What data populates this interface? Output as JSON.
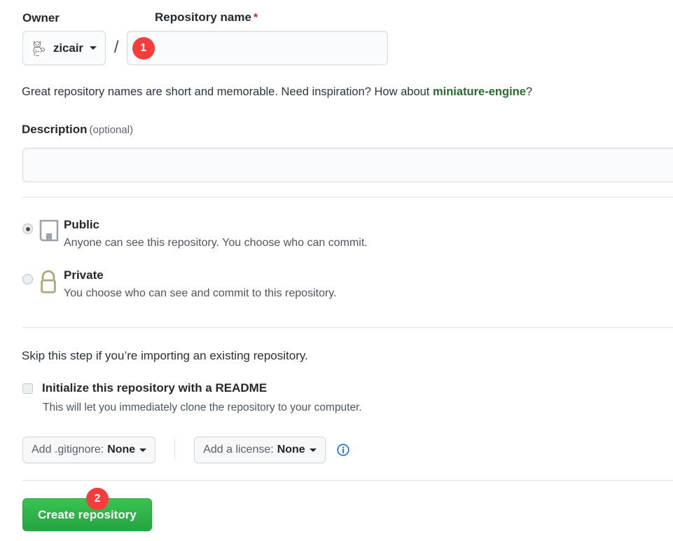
{
  "form": {
    "owner": {
      "label": "Owner",
      "name": "zicair",
      "avatar_icon": "user-avatar-sketch"
    },
    "separator": "/",
    "repository_name": {
      "label": "Repository name",
      "required_marker": "*",
      "value": "",
      "placeholder": ""
    },
    "hint": {
      "prefix": "Great repository names are short and memorable. Need inspiration? How about ",
      "suggestion": "miniature-engine",
      "suffix": "?",
      "suggestion_color": "#2b6a30"
    },
    "description": {
      "label": "Description",
      "optional_label": "(optional)",
      "value": "",
      "placeholder": ""
    },
    "visibility": {
      "selected": "public",
      "options": [
        {
          "id": "public",
          "title": "Public",
          "description": "Anyone can see this repository. You choose who can commit.",
          "icon": "repo-book-icon",
          "icon_color": "#8b949e",
          "checked": true
        },
        {
          "id": "private",
          "title": "Private",
          "description": "You choose who can see and commit to this repository.",
          "icon": "lock-icon",
          "icon_color": "#b3a57a",
          "checked": false
        }
      ]
    },
    "initialize": {
      "skip_note": "Skip this step if you’re importing an existing repository.",
      "readme_label": "Initialize this repository with a README",
      "readme_sublabel": "This will let you immediately clone the repository to your computer.",
      "readme_checked": false
    },
    "gitignore": {
      "prefix": "Add .gitignore:",
      "value": "None"
    },
    "license": {
      "prefix": "Add a license:",
      "value": "None",
      "info_icon": "info-circle-icon",
      "info_icon_color": "#0366d6"
    },
    "submit": {
      "label": "Create repository",
      "color": "#2ea44f"
    }
  },
  "annotations": {
    "badges": [
      {
        "id": "badge-1",
        "text": "1",
        "target": "repository-name-input",
        "color": "#f73c3c"
      },
      {
        "id": "badge-2",
        "text": "2",
        "target": "create-repository-button",
        "color": "#f73c3c"
      }
    ]
  }
}
